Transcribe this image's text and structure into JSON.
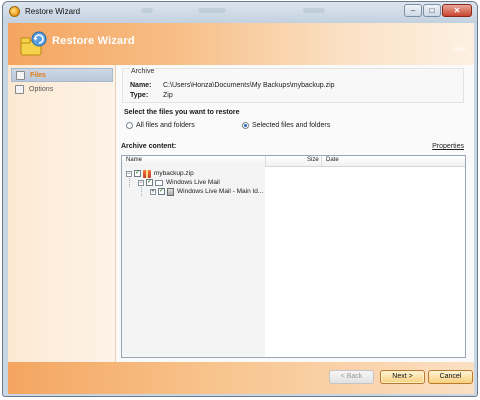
{
  "window": {
    "title": "Restore Wizard"
  },
  "banner": {
    "title": "Restore Wizard",
    "right_text": "Files"
  },
  "sidebar": {
    "items": [
      {
        "label": "Files",
        "active": true
      },
      {
        "label": "Options",
        "active": false
      }
    ]
  },
  "archive": {
    "group_title": "Archive",
    "name_label": "Name:",
    "name_value": "C:\\Users\\Honza\\Documents\\My Backups\\mybackup.zip",
    "type_label": "Type:",
    "type_value": "Zip"
  },
  "restore_section": {
    "title": "Select the files you want to restore",
    "options": [
      {
        "label": "All files and folders",
        "selected": false
      },
      {
        "label": "Selected files and folders",
        "selected": true
      }
    ]
  },
  "archive_content": {
    "label": "Archive content:",
    "properties_link": "Properties",
    "columns": [
      "Name",
      "Size",
      "Date"
    ],
    "tree": [
      {
        "label": "mybackup.zip",
        "expander": "−",
        "checked": true,
        "icon": "zip-icon"
      },
      {
        "label": "Windows Live Mail",
        "expander": "−",
        "checked": true,
        "icon": "mail-icon"
      },
      {
        "label": "Windows Live Mail - Main Id...",
        "expander": "+",
        "checked": true,
        "icon": "database-icon"
      }
    ]
  },
  "footer": {
    "back_label": "< Back",
    "next_label": "Next >",
    "cancel_label": "Cancel"
  },
  "colors": {
    "accent_orange": "#f4a560",
    "active_text": "#e37a15"
  }
}
